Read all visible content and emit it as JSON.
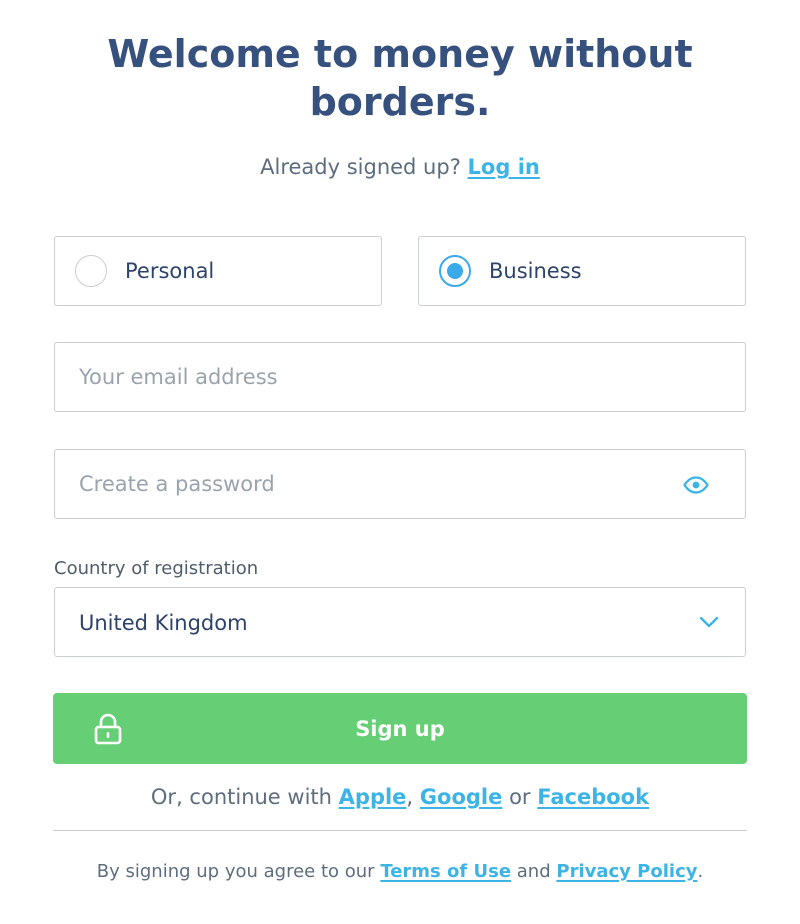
{
  "header": {
    "title": "Welcome to money without borders.",
    "already_text": "Already signed up?",
    "login_link": "Log in"
  },
  "account_type": {
    "options": [
      {
        "label": "Personal",
        "selected": false
      },
      {
        "label": "Business",
        "selected": true
      }
    ]
  },
  "form": {
    "email_placeholder": "Your email address",
    "email_value": "",
    "password_placeholder": "Create a password",
    "password_value": "",
    "password_toggle_icon": "eye-icon",
    "country_label": "Country of registration",
    "country_value": "United Kingdom",
    "country_dropdown_icon": "chevron-down-icon"
  },
  "signup": {
    "label": "Sign up",
    "icon": "lock-icon"
  },
  "social": {
    "prefix": "Or, continue with",
    "apple": "Apple",
    "comma": ",",
    "google": "Google",
    "or": "or",
    "facebook": "Facebook"
  },
  "legal": {
    "prefix": "By signing up you agree to our",
    "terms": "Terms of Use",
    "and": "and",
    "privacy": "Privacy Policy",
    "suffix": "."
  },
  "colors": {
    "title": "#37517e",
    "link": "#3cb4e5",
    "primary_button": "#66cf76",
    "radio_selected": "#3ca9e8",
    "border": "#c9ced3"
  }
}
